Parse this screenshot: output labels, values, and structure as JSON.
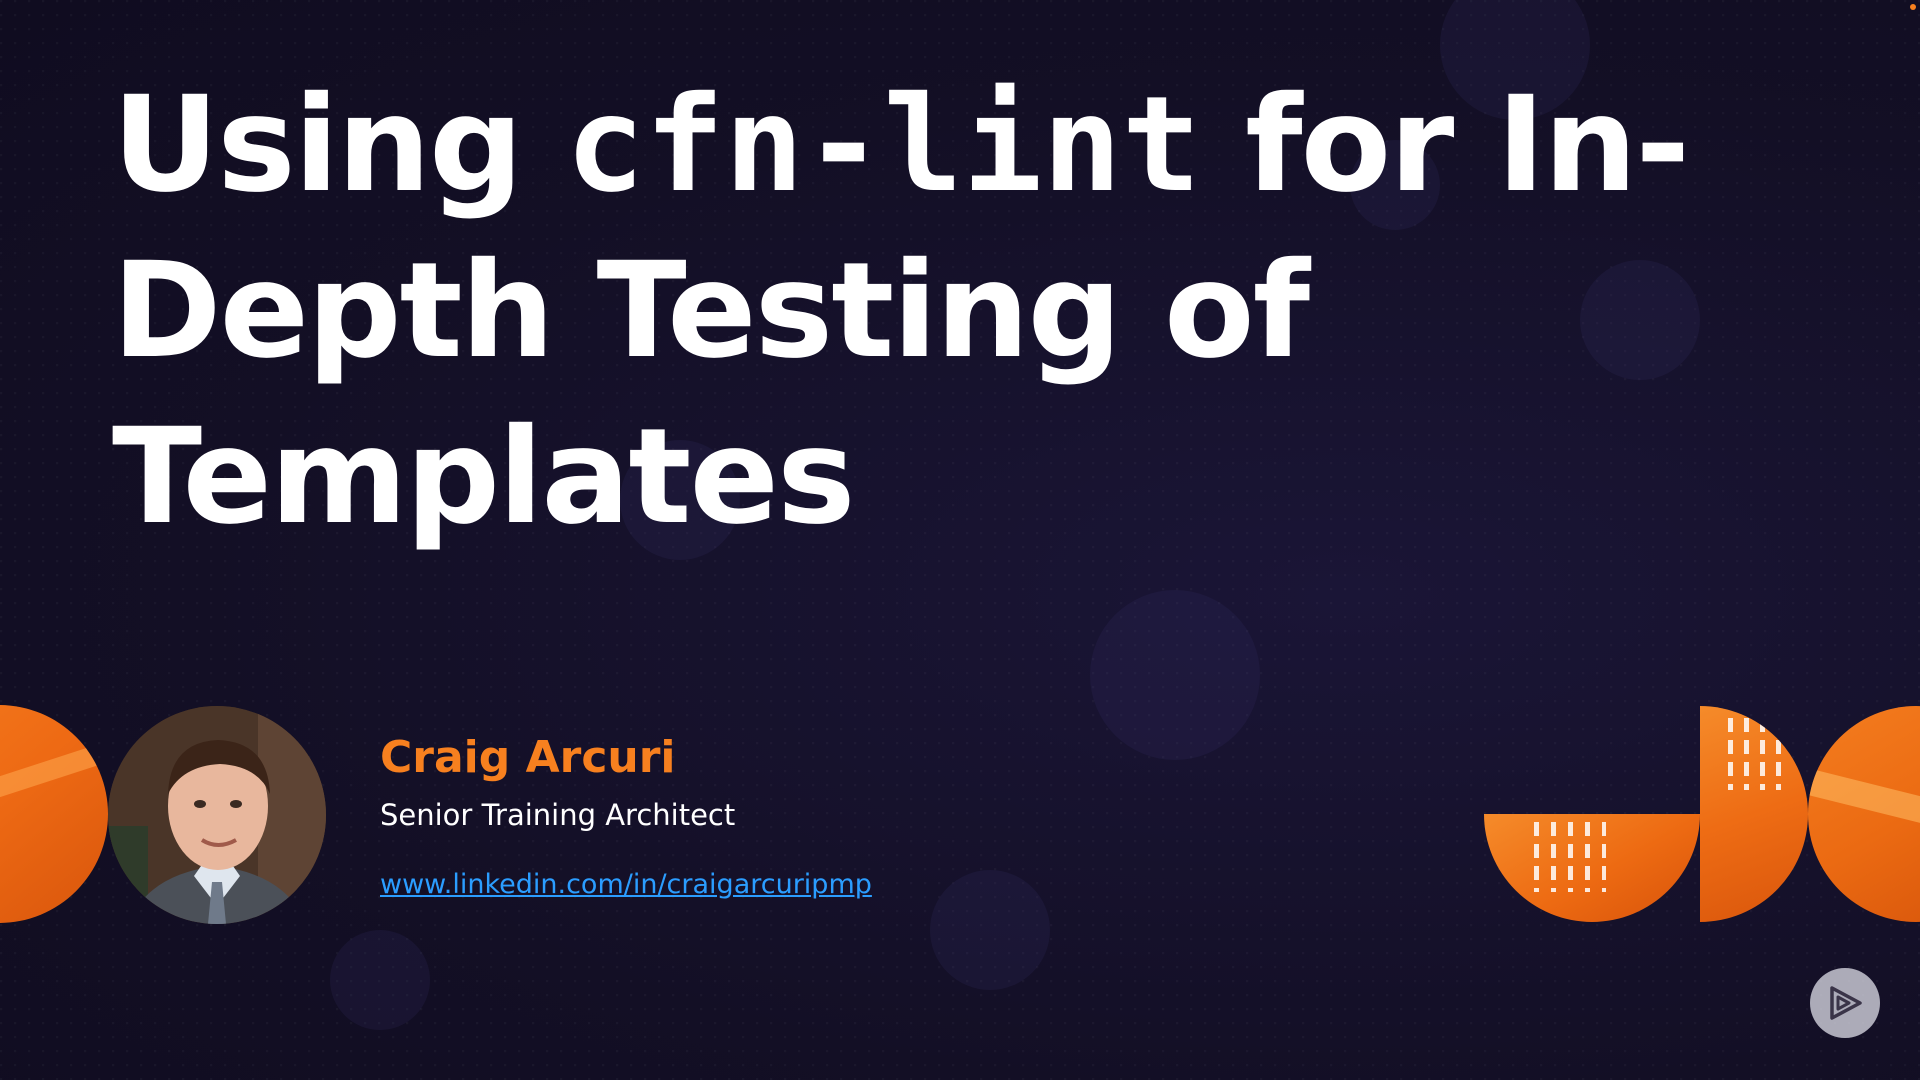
{
  "slide": {
    "title_before": "Using ",
    "title_code": "cfn-lint",
    "title_after": " for In-Depth Testing of Templates"
  },
  "presenter": {
    "name": "Craig Arcuri",
    "role": "Senior Training Architect",
    "link": "www.linkedin.com/in/craigarcuripmp"
  },
  "colors": {
    "background": "#130f25",
    "title_text": "#ffffff",
    "accent_orange": "#f7801f",
    "link_blue": "#2b9dff"
  },
  "icons": {
    "play_badge": "play-logo-icon"
  }
}
